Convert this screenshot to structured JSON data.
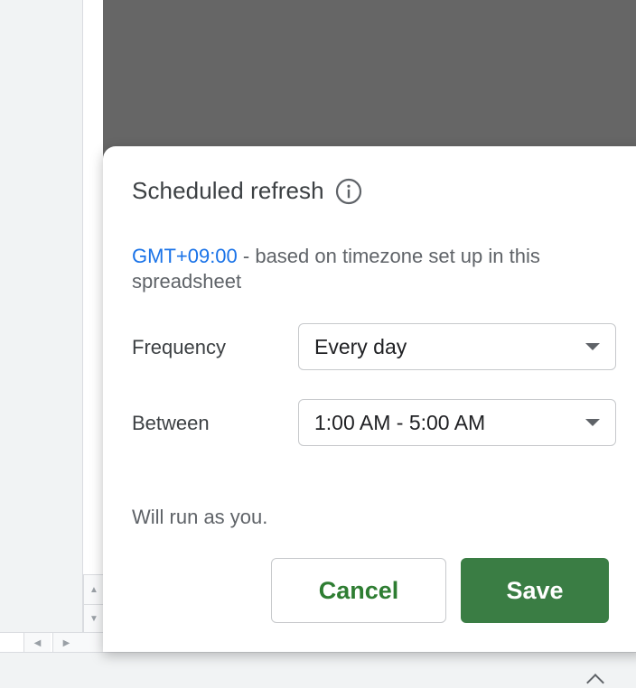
{
  "dialog": {
    "title": "Scheduled refresh",
    "info_icon": "info-icon",
    "timezone_link": "GMT+09:00",
    "timezone_note": " - based on timezone set up in this spreadsheet",
    "frequency": {
      "label": "Frequency",
      "selected": "Every day"
    },
    "between": {
      "label": "Between",
      "selected": "1:00 AM - 5:00 AM"
    },
    "run_as": "Will run as you.",
    "cancel_label": "Cancel",
    "save_label": "Save"
  },
  "colors": {
    "overlay": "#666666",
    "link": "#1a73e8",
    "save": "#3a7d44",
    "cancel_text": "#2e7d32"
  },
  "icons": {
    "scroll_up": "triangle-up-icon",
    "scroll_down": "triangle-down-icon",
    "scroll_left": "triangle-left-icon",
    "scroll_right": "triangle-right-icon",
    "dropdown": "chevron-down-icon"
  }
}
